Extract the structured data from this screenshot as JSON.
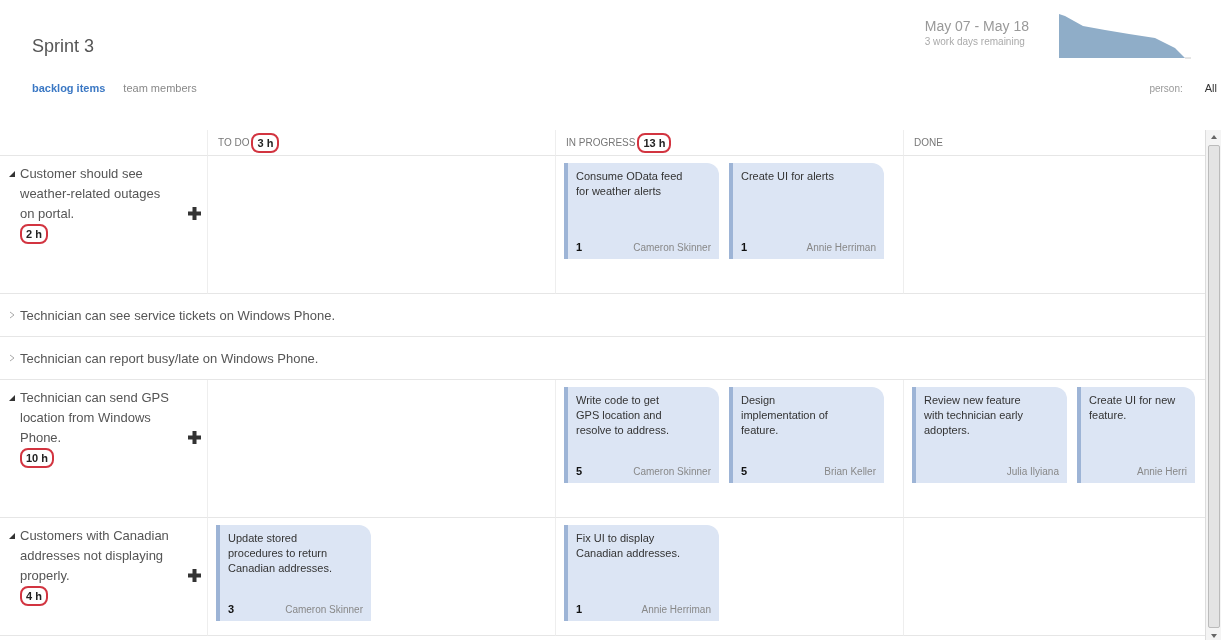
{
  "sprint": {
    "title": "Sprint 3",
    "dates": "May 07 - May 18",
    "remaining": "3 work days remaining"
  },
  "tabs": [
    {
      "label": "backlog items",
      "selected": true
    },
    {
      "label": "team members",
      "selected": false
    }
  ],
  "person_filter": {
    "label": "person:",
    "value": "All"
  },
  "columns": [
    {
      "title": "TO DO",
      "hours": "3 h",
      "circled": true
    },
    {
      "title": "IN PROGRESS",
      "hours": "13 h",
      "circled": true
    },
    {
      "title": "DONE"
    }
  ],
  "rows": [
    {
      "title": "Customer should see weather-related outages on portal.",
      "expanded": true,
      "hours": "2 h",
      "circled": true,
      "cells": [
        [],
        [
          {
            "title": "Consume OData feed for weather alerts",
            "points": "1",
            "assignee": "Cameron Skinner"
          },
          {
            "title": "Create UI for alerts",
            "points": "1",
            "assignee": "Annie Herriman"
          }
        ],
        []
      ]
    },
    {
      "title": "Technician can see service tickets on Windows Phone.",
      "expanded": false
    },
    {
      "title": "Technician can report busy/late on Windows Phone.",
      "expanded": false
    },
    {
      "title": "Technician can send GPS location from Windows Phone.",
      "expanded": true,
      "hours": "10 h",
      "circled": true,
      "cells": [
        [],
        [
          {
            "title": "Write code to get GPS location and resolve to address.",
            "points": "5",
            "assignee": "Cameron Skinner"
          },
          {
            "title": "Design implementation of feature.",
            "points": "5",
            "assignee": "Brian Keller"
          }
        ],
        [
          {
            "title": "Review new feature with technician early adopters.",
            "assignee": "Julia Ilyiana"
          },
          {
            "title": "Create UI for new feature.",
            "assignee": "Annie Herri",
            "cut": true
          }
        ]
      ]
    },
    {
      "title": "Customers with Canadian addresses not displaying properly.",
      "expanded": true,
      "hours": "4 h",
      "circled": true,
      "cells": [
        [
          {
            "title": "Update stored procedures to return Canadian addresses.",
            "points": "3",
            "assignee": "Cameron Skinner"
          }
        ],
        [
          {
            "title": "Fix UI to display Canadian addresses.",
            "points": "1",
            "assignee": "Annie Herriman"
          }
        ],
        []
      ]
    }
  ]
}
